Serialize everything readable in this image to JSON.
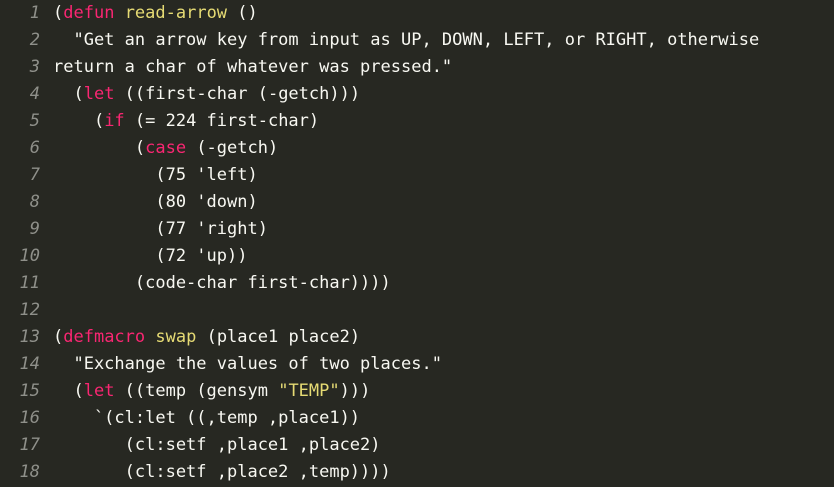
{
  "editor": {
    "lines": [
      {
        "number": "1",
        "tokens": [
          {
            "text": "(",
            "kind": "plain"
          },
          {
            "text": "defun",
            "kind": "kw"
          },
          {
            "text": " ",
            "kind": "plain"
          },
          {
            "text": "read-arrow",
            "kind": "fn"
          },
          {
            "text": " ()",
            "kind": "plain"
          }
        ]
      },
      {
        "number": "2",
        "tokens": [
          {
            "text": "  \"Get an arrow key from input as UP, DOWN, LEFT, or RIGHT, otherwise",
            "kind": "plain"
          }
        ]
      },
      {
        "number": "3",
        "tokens": [
          {
            "text": "return a char of whatever was pressed.\"",
            "kind": "plain"
          }
        ]
      },
      {
        "number": "4",
        "tokens": [
          {
            "text": "  (",
            "kind": "plain"
          },
          {
            "text": "let",
            "kind": "kw"
          },
          {
            "text": " ((first-char (-getch)))",
            "kind": "plain"
          }
        ]
      },
      {
        "number": "5",
        "tokens": [
          {
            "text": "    (",
            "kind": "plain"
          },
          {
            "text": "if",
            "kind": "kw"
          },
          {
            "text": " (= 224 first-char)",
            "kind": "plain"
          }
        ]
      },
      {
        "number": "6",
        "tokens": [
          {
            "text": "        (",
            "kind": "plain"
          },
          {
            "text": "case",
            "kind": "kw"
          },
          {
            "text": " (-getch)",
            "kind": "plain"
          }
        ]
      },
      {
        "number": "7",
        "tokens": [
          {
            "text": "          (75 'left)",
            "kind": "plain"
          }
        ]
      },
      {
        "number": "8",
        "tokens": [
          {
            "text": "          (80 'down)",
            "kind": "plain"
          }
        ]
      },
      {
        "number": "9",
        "tokens": [
          {
            "text": "          (77 'right)",
            "kind": "plain"
          }
        ]
      },
      {
        "number": "10",
        "tokens": [
          {
            "text": "          (72 'up))",
            "kind": "plain"
          }
        ]
      },
      {
        "number": "11",
        "tokens": [
          {
            "text": "        (code-char first-char))))",
            "kind": "plain"
          }
        ]
      },
      {
        "number": "12",
        "tokens": []
      },
      {
        "number": "13",
        "tokens": [
          {
            "text": "(",
            "kind": "plain"
          },
          {
            "text": "defmacro",
            "kind": "kw"
          },
          {
            "text": " ",
            "kind": "plain"
          },
          {
            "text": "swap",
            "kind": "fn"
          },
          {
            "text": " (place1 place2)",
            "kind": "plain"
          }
        ]
      },
      {
        "number": "14",
        "tokens": [
          {
            "text": "  \"Exchange the values of two places.\"",
            "kind": "plain"
          }
        ]
      },
      {
        "number": "15",
        "tokens": [
          {
            "text": "  (",
            "kind": "plain"
          },
          {
            "text": "let",
            "kind": "kw"
          },
          {
            "text": " ((temp (gensym ",
            "kind": "plain"
          },
          {
            "text": "\"TEMP\"",
            "kind": "str"
          },
          {
            "text": ")))",
            "kind": "plain"
          }
        ]
      },
      {
        "number": "16",
        "tokens": [
          {
            "text": "    `(cl:let ((,temp ,place1))",
            "kind": "plain"
          }
        ]
      },
      {
        "number": "17",
        "tokens": [
          {
            "text": "       (cl:setf ,place1 ,place2)",
            "kind": "plain"
          }
        ]
      },
      {
        "number": "18",
        "tokens": [
          {
            "text": "       (cl:setf ,place2 ,temp))))",
            "kind": "plain"
          }
        ]
      }
    ]
  },
  "colors": {
    "background": "#272822",
    "text": "#f8f8f2",
    "keyword": "#f92672",
    "function_name": "#e6db74",
    "string_highlight": "#e6db74",
    "line_number": "#8f908a"
  }
}
